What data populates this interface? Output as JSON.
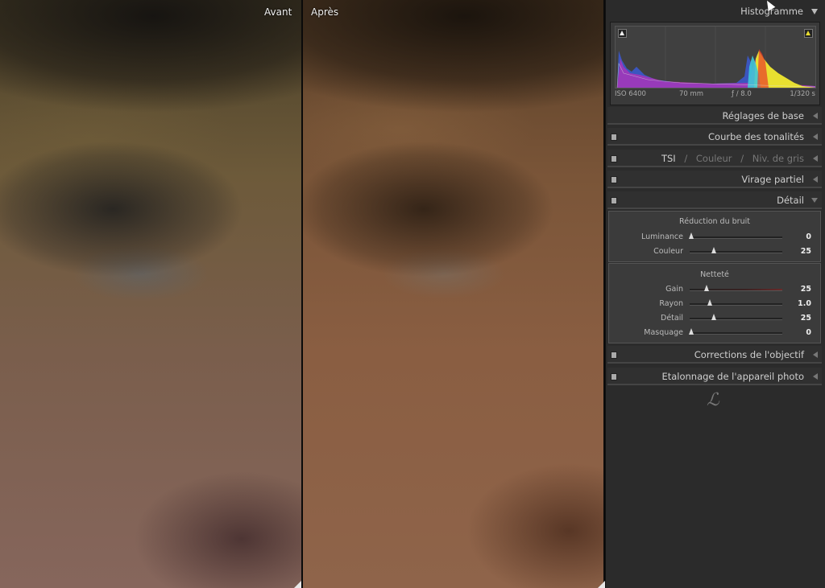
{
  "photos": {
    "before_label": "Avant",
    "after_label": "Après"
  },
  "histogram": {
    "title": "Histogramme",
    "iso": "ISO 6400",
    "focal": "70 mm",
    "aperture": "ƒ / 8.0",
    "shutter": "1/320 s"
  },
  "sections": {
    "basic": "Réglages de base",
    "tone_curve": "Courbe des tonalités",
    "tsi": "TSI",
    "sep1": "/",
    "couleur": "Couleur",
    "sep2": "/",
    "niv_gris": "Niv. de gris",
    "split_toning": "Virage partiel",
    "detail": "Détail",
    "lens": "Corrections de l'objectif",
    "camera": "Etalonnage de l'appareil photo"
  },
  "detail": {
    "noise_title": "Réduction du bruit",
    "sharpen_title": "Netteté",
    "noise_sliders": [
      {
        "label": "Luminance",
        "value": "0",
        "fraction": 0.0
      },
      {
        "label": "Couleur",
        "value": "25",
        "fraction": 0.25
      }
    ],
    "sharpen_sliders": [
      {
        "label": "Gain",
        "value": "25",
        "fraction": 0.167
      },
      {
        "label": "Rayon",
        "value": "1.0",
        "fraction": 0.2
      },
      {
        "label": "Détail",
        "value": "25",
        "fraction": 0.25
      },
      {
        "label": "Masquage",
        "value": "0",
        "fraction": 0.0
      }
    ]
  },
  "colors": {
    "panel_bg": "#2b2b2b",
    "highlight_clip": "#e8dc30"
  }
}
